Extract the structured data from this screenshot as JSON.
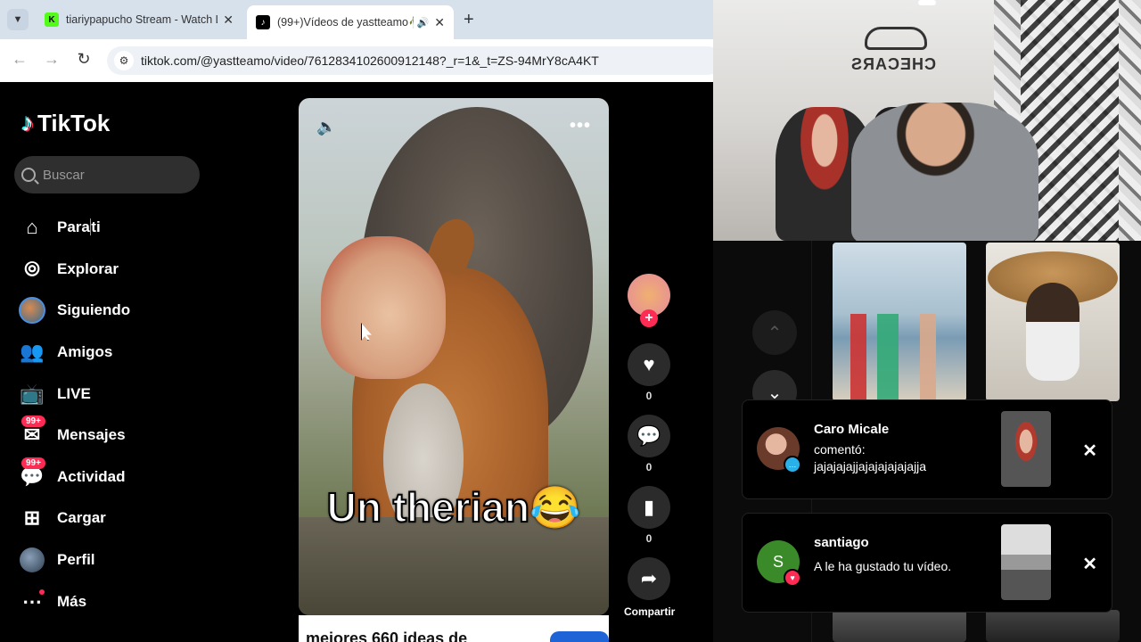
{
  "browser": {
    "tabs": [
      {
        "title": "tiariypapucho Stream - Watch L",
        "active": false,
        "favicon": "kick-icon"
      },
      {
        "title": "(99+)Vídeos de yastteamo🥀",
        "active": true,
        "favicon": "tiktok-icon",
        "audio": true
      }
    ],
    "url": "tiktok.com/@yastteamo/video/7612834102600912148?_r=1&_t=ZS-94MrY8cA4KT"
  },
  "tiktok": {
    "logo": "TikTok",
    "search_placeholder": "Buscar",
    "nav": [
      {
        "label_a": "Para",
        "label_b": "ti",
        "icon": "home-icon"
      },
      {
        "label": "Explorar",
        "icon": "compass-icon"
      },
      {
        "label": "Siguiendo",
        "icon": "avatar"
      },
      {
        "label": "Amigos",
        "icon": "friends-icon"
      },
      {
        "label": "LIVE",
        "icon": "live-tv-icon"
      },
      {
        "label": "Mensajes",
        "icon": "message-icon",
        "badge": "99+"
      },
      {
        "label": "Actividad",
        "icon": "inbox-icon",
        "badge": "99+"
      },
      {
        "label": "Cargar",
        "icon": "upload-icon"
      },
      {
        "label": "Perfil",
        "icon": "profile-avatar"
      },
      {
        "label": "Más",
        "icon": "more-icon"
      }
    ],
    "video": {
      "caption": "Un therian",
      "caption_emoji": "😂",
      "below_text": "mejores 660 ideas de"
    },
    "actions": {
      "like_count": "0",
      "comment_count": "0",
      "save_count": "0",
      "share_label": "Compartir"
    }
  },
  "webcam": {
    "sign_text": "CHECARS"
  },
  "notifications": [
    {
      "name": "Caro Micale",
      "line1": "comentó:",
      "line2": "jajajajajjajajajajajajja",
      "type": "comment"
    },
    {
      "name": "santiago",
      "avatar_letter": "S",
      "line1": "A le ha gustado tu vídeo.",
      "type": "like"
    }
  ],
  "colors": {
    "accent": "#fe2c55",
    "cyan": "#25f4ee",
    "search_bg": "#2f2f2f"
  }
}
